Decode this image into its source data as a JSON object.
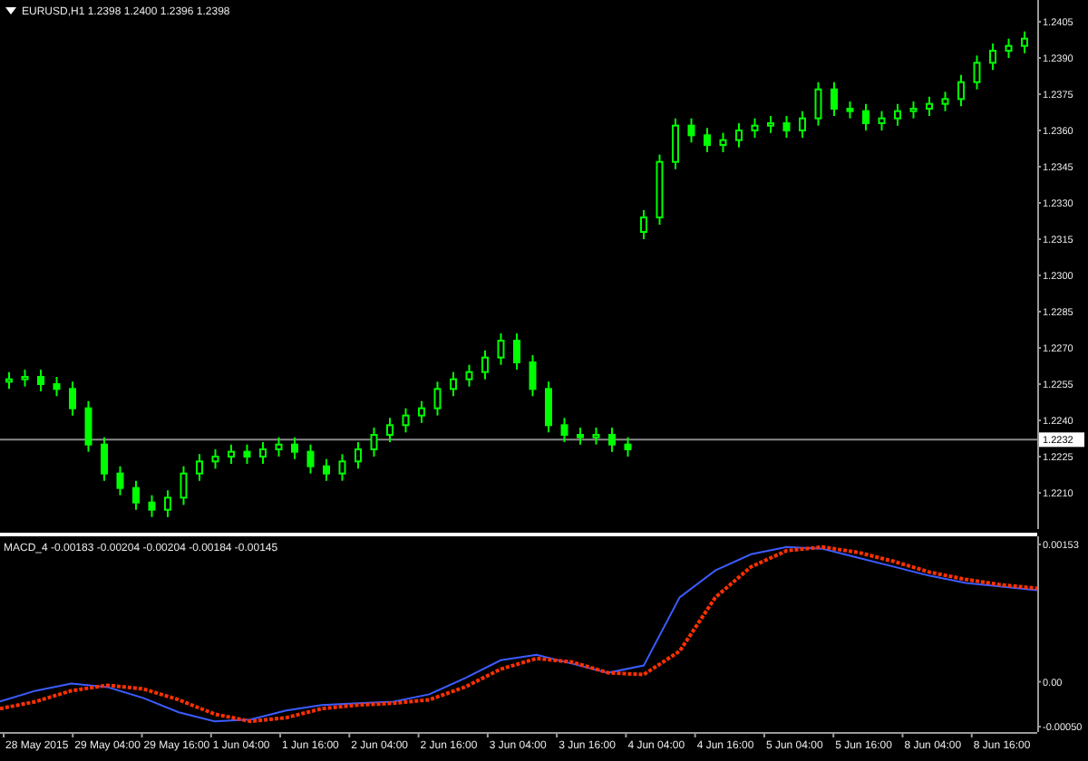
{
  "window": {
    "title": "EURUSD,H1 1.2398 1.2400 1.2396 1.2398"
  },
  "price_chart": {
    "chart_data": {
      "type": "candlestick",
      "ylim": [
        1.2195,
        1.2414
      ],
      "series": [
        {
          "color": "#00ff00",
          "ohlc": [
            [
              1.2256,
              1.226,
              1.2253,
              1.2257
            ],
            [
              1.2257,
              1.2261,
              1.2254,
              1.2258
            ],
            [
              1.2258,
              1.2261,
              1.2252,
              1.2255
            ],
            [
              1.2255,
              1.2258,
              1.225,
              1.2253
            ],
            [
              1.2253,
              1.2256,
              1.2242,
              1.2245
            ],
            [
              1.2245,
              1.2248,
              1.2227,
              1.223
            ],
            [
              1.223,
              1.2233,
              1.2215,
              1.2218
            ],
            [
              1.2218,
              1.2221,
              1.2209,
              1.2212
            ],
            [
              1.2212,
              1.2215,
              1.2203,
              1.2206
            ],
            [
              1.2206,
              1.2209,
              1.22,
              1.2203
            ],
            [
              1.2203,
              1.2211,
              1.22,
              1.2208
            ],
            [
              1.2208,
              1.2221,
              1.2205,
              1.2218
            ],
            [
              1.2218,
              1.2226,
              1.2215,
              1.2223
            ],
            [
              1.2223,
              1.2228,
              1.222,
              1.2225
            ],
            [
              1.2225,
              1.223,
              1.2222,
              1.2227
            ],
            [
              1.2227,
              1.223,
              1.2222,
              1.2225
            ],
            [
              1.2225,
              1.2231,
              1.2222,
              1.2228
            ],
            [
              1.2228,
              1.2233,
              1.2225,
              1.223
            ],
            [
              1.223,
              1.2233,
              1.2224,
              1.2227
            ],
            [
              1.2227,
              1.223,
              1.2218,
              1.2221
            ],
            [
              1.2221,
              1.2224,
              1.2215,
              1.2218
            ],
            [
              1.2218,
              1.2226,
              1.2215,
              1.2223
            ],
            [
              1.2223,
              1.2231,
              1.222,
              1.2228
            ],
            [
              1.2228,
              1.2237,
              1.2225,
              1.2234
            ],
            [
              1.2234,
              1.2241,
              1.2231,
              1.2238
            ],
            [
              1.2238,
              1.2245,
              1.2235,
              1.2242
            ],
            [
              1.2242,
              1.2248,
              1.2239,
              1.2245
            ],
            [
              1.2245,
              1.2256,
              1.2242,
              1.2253
            ],
            [
              1.2253,
              1.226,
              1.225,
              1.2257
            ],
            [
              1.2257,
              1.2263,
              1.2254,
              1.226
            ],
            [
              1.226,
              1.2269,
              1.2257,
              1.2266
            ],
            [
              1.2266,
              1.2276,
              1.2263,
              1.2273
            ],
            [
              1.2273,
              1.2276,
              1.2261,
              1.2264
            ],
            [
              1.2264,
              1.2267,
              1.225,
              1.2253
            ],
            [
              1.2253,
              1.2256,
              1.2235,
              1.2238
            ],
            [
              1.2238,
              1.2241,
              1.2231,
              1.2234
            ],
            [
              1.2234,
              1.2237,
              1.223,
              1.2233
            ],
            [
              1.2233,
              1.2237,
              1.223,
              1.2234
            ],
            [
              1.2234,
              1.2237,
              1.2227,
              1.223
            ],
            [
              1.223,
              1.2233,
              1.2225,
              1.2228
            ],
            [
              1.2318,
              1.2327,
              1.2315,
              1.2324
            ],
            [
              1.2324,
              1.235,
              1.2321,
              1.2347
            ],
            [
              1.2347,
              1.2365,
              1.2344,
              1.2362
            ],
            [
              1.2362,
              1.2365,
              1.2355,
              1.2358
            ],
            [
              1.2358,
              1.2361,
              1.2351,
              1.2354
            ],
            [
              1.2354,
              1.2359,
              1.2351,
              1.2356
            ],
            [
              1.2356,
              1.2363,
              1.2353,
              1.236
            ],
            [
              1.236,
              1.2365,
              1.2357,
              1.2362
            ],
            [
              1.2362,
              1.2366,
              1.2359,
              1.2363
            ],
            [
              1.2363,
              1.2366,
              1.2357,
              1.236
            ],
            [
              1.236,
              1.2368,
              1.2357,
              1.2365
            ],
            [
              1.2365,
              1.238,
              1.2362,
              1.2377
            ],
            [
              1.2377,
              1.238,
              1.2366,
              1.2369
            ],
            [
              1.2369,
              1.2372,
              1.2365,
              1.2368
            ],
            [
              1.2368,
              1.2371,
              1.236,
              1.2363
            ],
            [
              1.2363,
              1.2368,
              1.236,
              1.2365
            ],
            [
              1.2365,
              1.2371,
              1.2362,
              1.2368
            ],
            [
              1.2368,
              1.2372,
              1.2365,
              1.2369
            ],
            [
              1.2369,
              1.2374,
              1.2366,
              1.2371
            ],
            [
              1.2371,
              1.2376,
              1.2368,
              1.2373
            ],
            [
              1.2373,
              1.2383,
              1.237,
              1.238
            ],
            [
              1.238,
              1.2391,
              1.2377,
              1.2388
            ],
            [
              1.2388,
              1.2396,
              1.2385,
              1.2393
            ],
            [
              1.2393,
              1.2398,
              1.239,
              1.2395
            ],
            [
              1.2395,
              1.2401,
              1.2392,
              1.2398
            ]
          ]
        }
      ],
      "yticks": [
        {
          "value": 1.2405,
          "label": "1.2405"
        },
        {
          "value": 1.239,
          "label": "1.2390"
        },
        {
          "value": 1.2375,
          "label": "1.2375"
        },
        {
          "value": 1.236,
          "label": "1.2360"
        },
        {
          "value": 1.2345,
          "label": "1.2345"
        },
        {
          "value": 1.233,
          "label": "1.2330"
        },
        {
          "value": 1.2315,
          "label": "1.2315"
        },
        {
          "value": 1.23,
          "label": "1.2300"
        },
        {
          "value": 1.2285,
          "label": "1.2285"
        },
        {
          "value": 1.227,
          "label": "1.2270"
        },
        {
          "value": 1.2255,
          "label": "1.2255"
        },
        {
          "value": 1.224,
          "label": "1.2240"
        },
        {
          "value": 1.2225,
          "label": "1.2225"
        },
        {
          "value": 1.221,
          "label": "1.2210"
        }
      ],
      "ref_lines": [
        {
          "axis": "y",
          "value": 1.2232,
          "label": "1.2232"
        }
      ]
    }
  },
  "indicator": {
    "label": "MACD_4 -0.00183 -0.00204 -0.00204 -0.00184 -0.00145",
    "chart_data": {
      "type": "line",
      "ylim": [
        -0.00056,
        0.00162
      ],
      "series": [
        {
          "color": "#3c5cff",
          "values": [
            -0.00022,
            -0.0001,
            -2e-05,
            -6e-05,
            -0.00018,
            -0.00034,
            -0.00044,
            -0.00042,
            -0.00032,
            -0.00026,
            -0.00024,
            -0.00022,
            -0.00014,
            4e-05,
            0.00024,
            0.0003,
            0.0002,
            0.0001,
            0.00018,
            0.00094,
            0.00124,
            0.00142,
            0.0015,
            0.00148,
            0.00138,
            0.00128,
            0.00118,
            0.0011,
            0.00106,
            0.00102
          ]
        },
        {
          "color": "#ff3000",
          "line_style": "dashed",
          "values": [
            -0.0003,
            -0.00022,
            -0.0001,
            -4e-05,
            -8e-05,
            -0.0002,
            -0.00036,
            -0.00044,
            -0.0004,
            -0.0003,
            -0.00026,
            -0.00024,
            -0.0002,
            -6e-05,
            0.00014,
            0.00026,
            0.00022,
            0.0001,
            8e-05,
            0.00034,
            0.00094,
            0.00128,
            0.00146,
            0.0015,
            0.00144,
            0.00134,
            0.00122,
            0.00114,
            0.00108,
            0.00104
          ]
        }
      ],
      "yticks": [
        {
          "value": 0.00153,
          "label": "0.00153"
        },
        {
          "value": 0,
          "label": "0.00"
        },
        {
          "value": -0.0005,
          "label": "-0.00050"
        }
      ]
    }
  },
  "time_axis": {
    "labels": [
      "28 May 2015",
      "29 May 04:00",
      "29 May 16:00",
      "1 Jun 04:00",
      "1 Jun 16:00",
      "2 Jun 04:00",
      "2 Jun 16:00",
      "3 Jun 04:00",
      "3 Jun 16:00",
      "4 Jun 04:00",
      "4 Jun 16:00",
      "5 Jun 04:00",
      "5 Jun 16:00",
      "8 Jun 04:00",
      "8 Jun 16:00"
    ]
  }
}
